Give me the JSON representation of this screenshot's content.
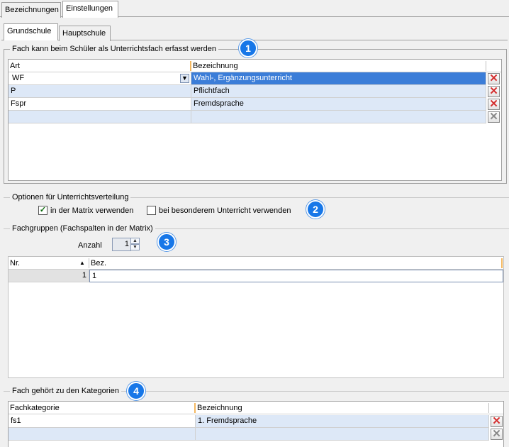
{
  "top_tabs": [
    {
      "label": "Bezeichnungen",
      "active": false
    },
    {
      "label": "Einstellungen",
      "active": true
    }
  ],
  "school_tabs": [
    {
      "label": "Grundschule",
      "active": true
    },
    {
      "label": "Hauptschule",
      "active": false
    }
  ],
  "section1": {
    "title": "Fach kann beim Schüler als Unterrichtsfach erfasst werden",
    "badge": "1",
    "columns": [
      "Art",
      "Bezeichnung"
    ],
    "rows": [
      {
        "art": "WF",
        "bezeichnung": "Wahl-, Ergänzungsunterricht",
        "selected": true
      },
      {
        "art": "P",
        "bezeichnung": "Pflichtfach",
        "selected": false
      },
      {
        "art": "Fspr",
        "bezeichnung": "Fremdsprache",
        "selected": false
      },
      {
        "art": "",
        "bezeichnung": "",
        "selected": false
      }
    ]
  },
  "section2": {
    "title": "Optionen für Unterrichtsverteilung",
    "badge": "2",
    "matrix_label": "in der Matrix verwenden",
    "matrix_checked": true,
    "special_label": "bei besonderem Unterricht verwenden",
    "special_checked": false
  },
  "section3": {
    "title": "Fachgruppen (Fachspalten in der Matrix)",
    "badge": "3",
    "anzahl_label": "Anzahl",
    "anzahl_value": "1",
    "columns": [
      "Nr.",
      "Bez."
    ],
    "rows": [
      {
        "nr": "1",
        "bez": "1"
      }
    ]
  },
  "section4": {
    "title": "Fach gehört zu den Kategorien",
    "badge": "4",
    "columns": [
      "Fachkategorie",
      "Bezeichnung"
    ],
    "rows": [
      {
        "kategorie": "fs1",
        "bezeichnung": "1. Fremdsprache"
      },
      {
        "kategorie": "",
        "bezeichnung": ""
      }
    ]
  },
  "colors": {
    "selection": "#3b7dd8",
    "badge": "#1777e8",
    "delete_icon": "#d43030"
  },
  "icons": {
    "delete": "close-x-icon",
    "dropdown": "chevron-down-icon",
    "sort": "sort-ascending-icon"
  }
}
